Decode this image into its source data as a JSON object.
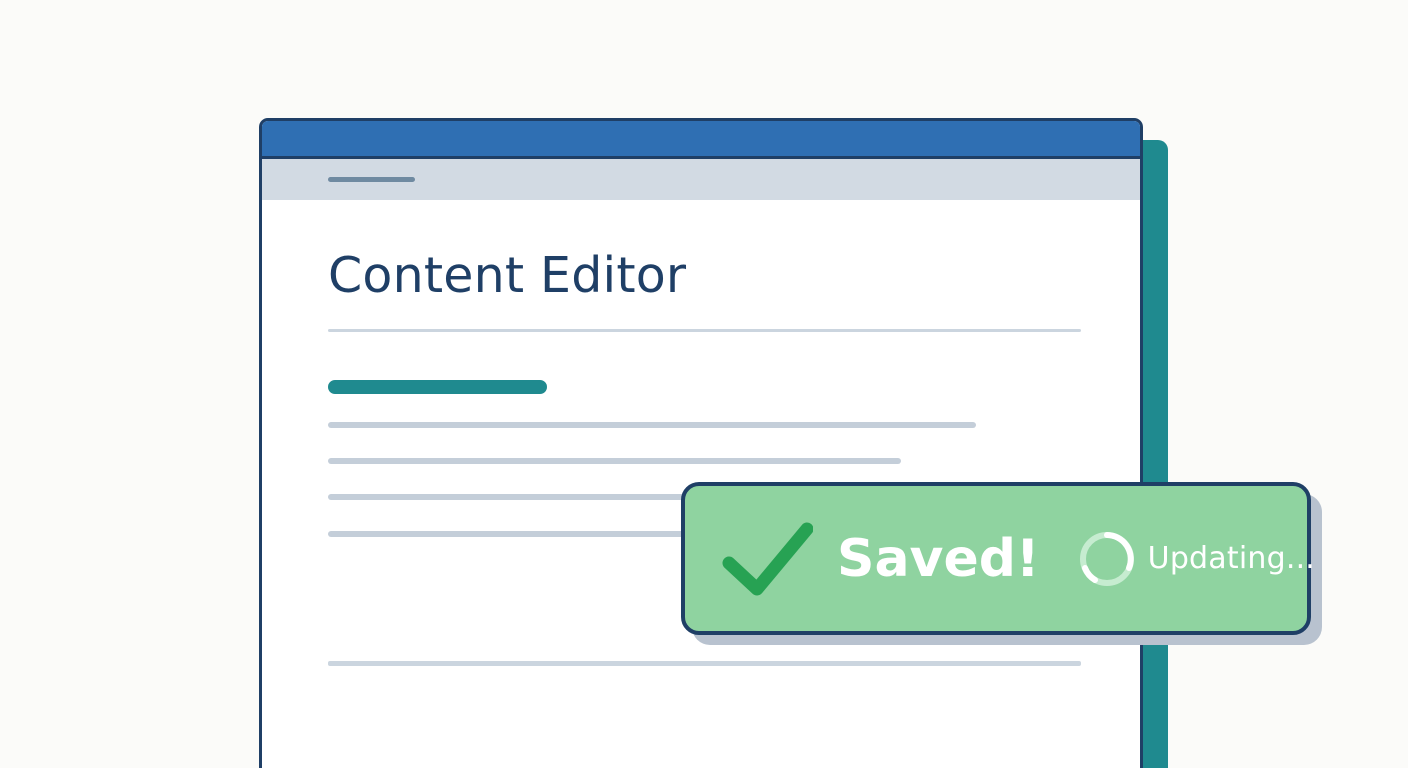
{
  "editor": {
    "title": "Content Editor"
  },
  "toast": {
    "status_label": "Saved!",
    "secondary_label": "Updating...",
    "check_icon": "checkmark-icon",
    "spinner_icon": "loading-spinner-icon"
  },
  "colors": {
    "window_border": "#1f3f66",
    "title_bar": "#2f6fb3",
    "toolbar": "#d2dae3",
    "accent": "#1f8a8f",
    "placeholder_lines": "#c4ced9",
    "toast_background": "#8fd3a0",
    "check": "#27a253",
    "text_on_toast": "#ffffff"
  }
}
